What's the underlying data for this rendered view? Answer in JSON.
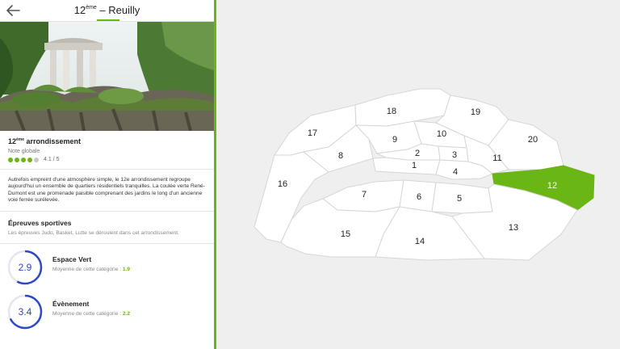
{
  "header": {
    "title_num": "12",
    "title_sup": "ème",
    "title_rest": " – Reuilly"
  },
  "icons": {
    "back": "arrow-left-icon"
  },
  "district": {
    "name_num": "12",
    "name_sup": "ème",
    "name_rest": " arrondissement",
    "rating_label": "Note globale",
    "rating": 4.1,
    "rating_text": "4.1 / 5",
    "description": "Autrefois empreint d'une atmosphère simple, le 12e arrondissement regroupe aujourd'hui un ensemble de quartiers résidentiels tranquilles. La coulée verte René-Dumont est une promenade paisible comprenant des jardins le long d'un ancienne voie ferrée surélevée."
  },
  "sports": {
    "title": "Épreuves sportives",
    "text": "Les épreuves Judo, Basket, Lutte se déroulent dans cet arrondissement."
  },
  "scores": [
    {
      "value": "2.9",
      "name": "Espace Vert",
      "avg_label": "Moyenne de cette catégorie : ",
      "avg": "1.9",
      "fraction": 0.58
    },
    {
      "value": "3.4",
      "name": "Évènement",
      "avg_label": "Moyenne de cette catégorie : ",
      "avg": "2.2",
      "fraction": 0.68
    }
  ],
  "map": {
    "selected": "12",
    "labels": [
      "1",
      "2",
      "3",
      "4",
      "5",
      "6",
      "7",
      "8",
      "9",
      "10",
      "11",
      "12",
      "13",
      "14",
      "15",
      "16",
      "17",
      "18",
      "19",
      "20"
    ]
  },
  "colors": {
    "accent": "#6ab614",
    "gauge": "#2e49c8"
  }
}
